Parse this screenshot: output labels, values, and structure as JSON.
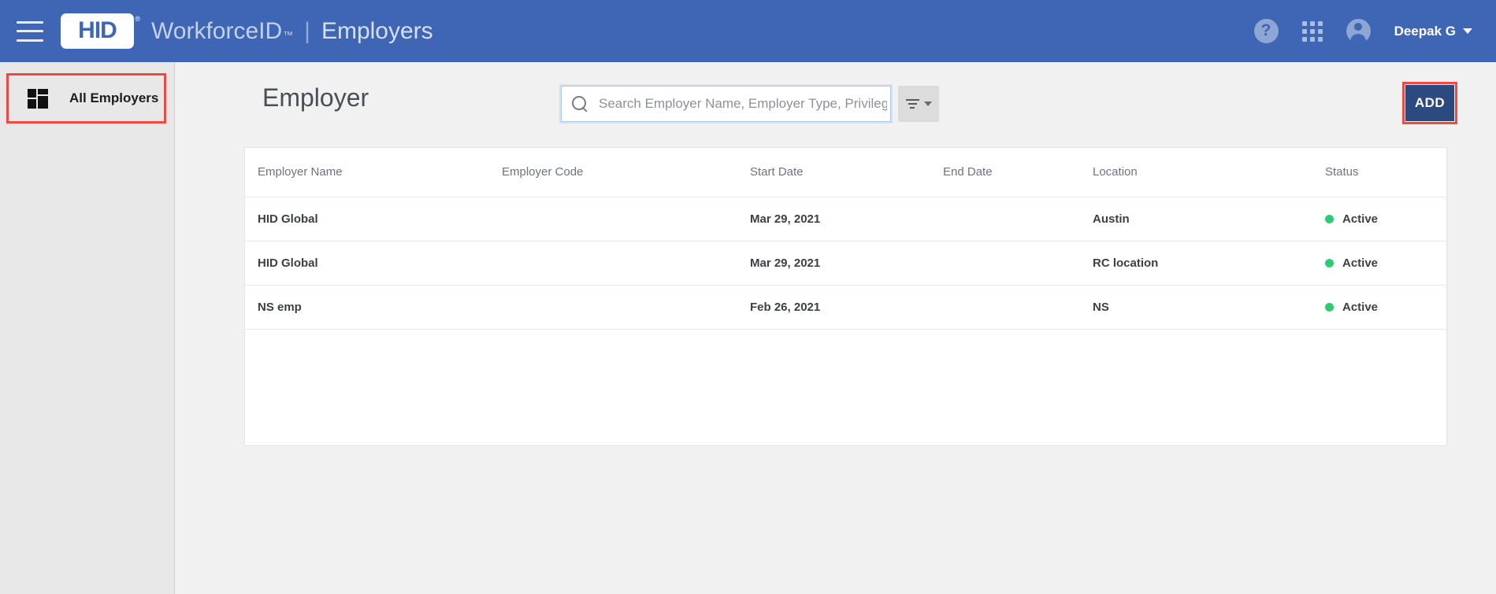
{
  "header": {
    "menu_icon": "hamburger-icon",
    "logo_text": "HID",
    "logo_registered": "®",
    "product_name": "WorkforceID",
    "product_tm": "™",
    "separator": "|",
    "section": "Employers",
    "help_icon": "?",
    "apps_icon": "grid-apps-icon",
    "avatar_icon": "user-avatar-icon",
    "user_name": "Deepak G",
    "bg_color": "#3f66b4"
  },
  "sidebar": {
    "items": [
      {
        "label": "All Employers",
        "icon": "dashboard-grid-icon",
        "selected": true,
        "highlighted": true
      }
    ],
    "bg_color": "#e8e8e8",
    "annotation_color": "#ee4a42"
  },
  "main": {
    "page_title": "Employer",
    "search": {
      "placeholder": "Search Employer Name, Employer Type, Privilege Name",
      "value": "",
      "icon": "search-icon"
    },
    "filter": {
      "icon": "filter-lines-icon",
      "caret": "chevron-down-icon"
    },
    "add_button": {
      "label": "ADD",
      "bg_color": "#2c4a80",
      "annotation_color": "#ee4a42"
    },
    "table": {
      "columns": [
        "Employer Name",
        "Employer Code",
        "Start Date",
        "End Date",
        "Location",
        "Status"
      ],
      "rows": [
        {
          "employer_name": "HID Global",
          "employer_code": "",
          "start_date": "Mar 29, 2021",
          "end_date": "",
          "location": "Austin",
          "status": "Active",
          "status_color": "#2ecc71"
        },
        {
          "employer_name": "HID Global",
          "employer_code": "",
          "start_date": "Mar 29, 2021",
          "end_date": "",
          "location": "RC location",
          "status": "Active",
          "status_color": "#2ecc71"
        },
        {
          "employer_name": "NS emp",
          "employer_code": "",
          "start_date": "Feb 26, 2021",
          "end_date": "",
          "location": "NS",
          "status": "Active",
          "status_color": "#2ecc71"
        }
      ]
    }
  }
}
